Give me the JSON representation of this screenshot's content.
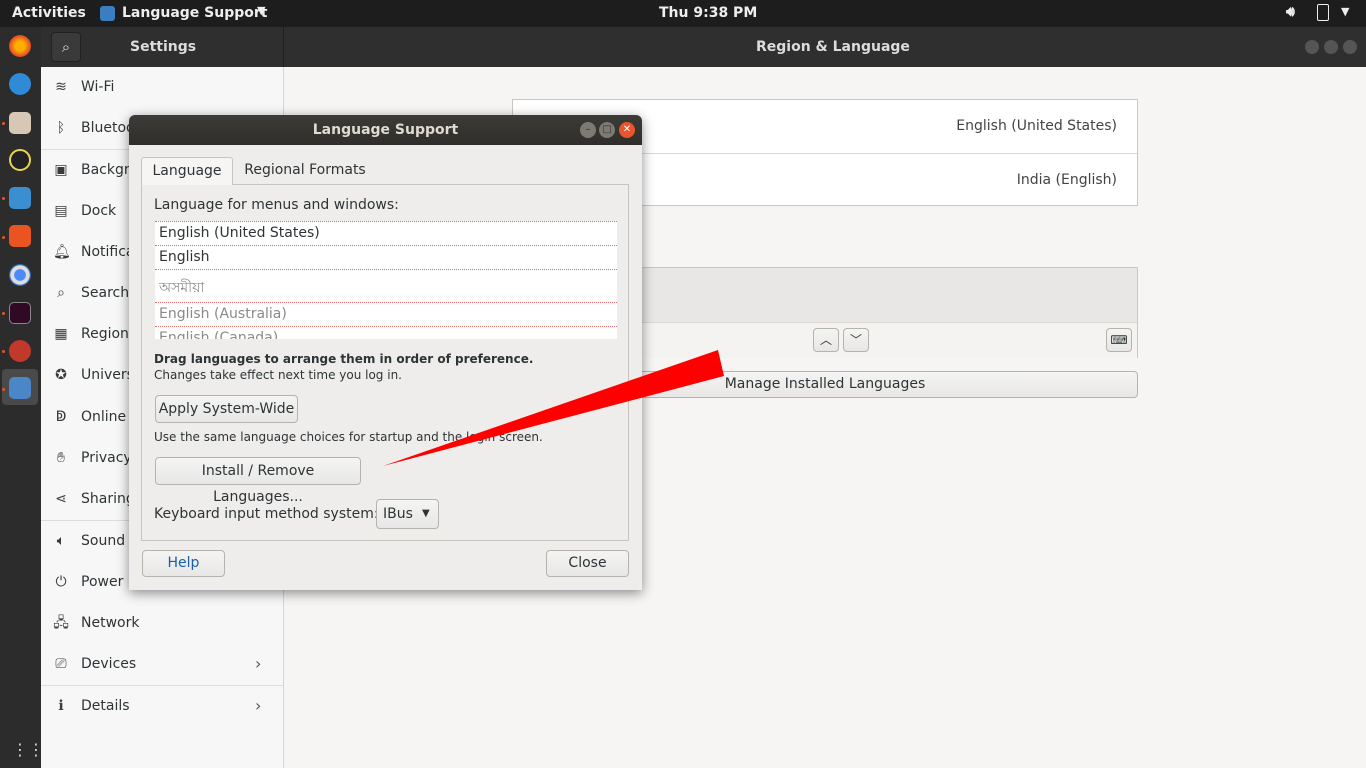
{
  "topbar": {
    "activities": "Activities",
    "app_menu": "Language Support",
    "clock": "Thu  9:38 PM"
  },
  "settings": {
    "title": "Settings",
    "page_title": "Region & Language",
    "sidebar": [
      {
        "label": "Wi-Fi",
        "icon": "wifi-icon"
      },
      {
        "label": "Bluetooth",
        "icon": "bluetooth-icon"
      },
      {
        "label": "Background",
        "icon": "background-icon"
      },
      {
        "label": "Dock",
        "icon": "dock-icon"
      },
      {
        "label": "Notifications",
        "icon": "bell-icon"
      },
      {
        "label": "Search",
        "icon": "search-icon"
      },
      {
        "label": "Region & Language",
        "icon": "region-icon"
      },
      {
        "label": "Universal Access",
        "icon": "accessibility-icon"
      },
      {
        "label": "Online Accounts",
        "icon": "online-accounts-icon"
      },
      {
        "label": "Privacy",
        "icon": "hand-icon"
      },
      {
        "label": "Sharing",
        "icon": "share-icon"
      },
      {
        "label": "Sound",
        "icon": "speaker-icon"
      },
      {
        "label": "Power",
        "icon": "power-plug-icon"
      },
      {
        "label": "Network",
        "icon": "network-icon"
      },
      {
        "label": "Devices",
        "icon": "devices-icon"
      },
      {
        "label": "Details",
        "icon": "info-icon"
      }
    ],
    "language_value": "English (United States)",
    "formats_value": "India (English)",
    "manage_button": "Manage Installed Languages"
  },
  "dialog": {
    "title": "Language Support",
    "tabs": [
      "Language",
      "Regional Formats"
    ],
    "list_heading": "Language for menus and windows:",
    "languages": [
      "English (United States)",
      "English",
      "অসমীয়া",
      "English (Australia)",
      "English (Canada)"
    ],
    "drag_hint_bold": "Drag languages to arrange them in order of preference.",
    "drag_hint": "Changes take effect next time you log in.",
    "apply_button": "Apply System-Wide",
    "apply_hint": "Use the same language choices for startup and the login screen.",
    "install_button": "Install / Remove Languages...",
    "input_method_label": "Keyboard input method system:",
    "input_method_value": "IBus",
    "help_button": "Help",
    "close_button": "Close"
  },
  "colors": {
    "arrow": "#ff0000",
    "accent": "#e95420",
    "titlebar": "#3c3b37"
  }
}
